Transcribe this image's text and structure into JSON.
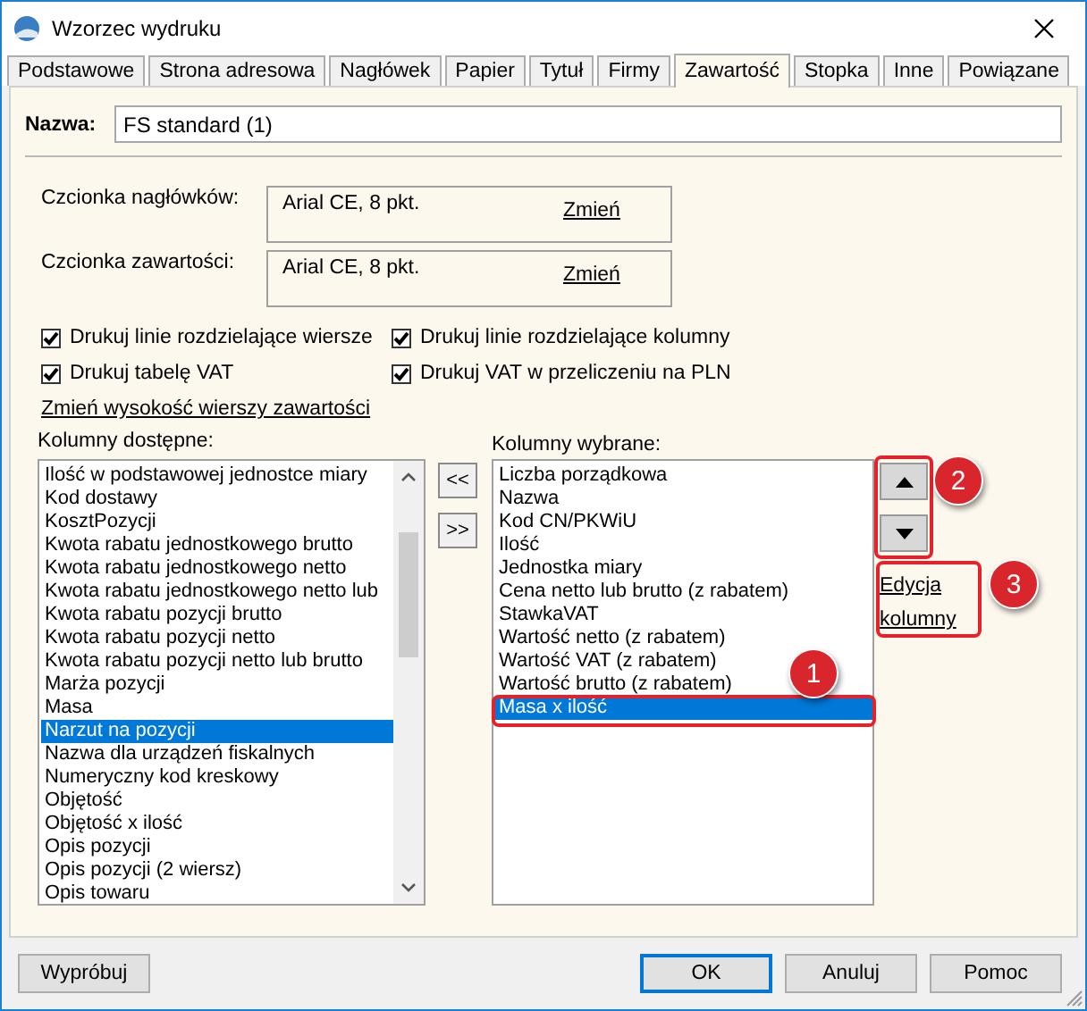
{
  "window": {
    "title": "Wzorzec wydruku"
  },
  "tabs": [
    {
      "label": "Podstawowe",
      "selected": false
    },
    {
      "label": "Strona adresowa",
      "selected": false
    },
    {
      "label": "Nagłówek",
      "selected": false
    },
    {
      "label": "Papier",
      "selected": false
    },
    {
      "label": "Tytuł",
      "selected": false
    },
    {
      "label": "Firmy",
      "selected": false
    },
    {
      "label": "Zawartość",
      "selected": true
    },
    {
      "label": "Stopka",
      "selected": false
    },
    {
      "label": "Inne",
      "selected": false
    },
    {
      "label": "Powiązane",
      "selected": false
    }
  ],
  "name_field": {
    "label": "Nazwa:",
    "value": "FS standard (1)"
  },
  "fonts": [
    {
      "label": "Czcionka nagłówków:",
      "value": "Arial CE, 8 pkt.",
      "link": "Zmień"
    },
    {
      "label": "Czcionka zawartości:",
      "value": "Arial CE, 8 pkt.",
      "link": "Zmień"
    }
  ],
  "checkboxes": [
    {
      "label": "Drukuj linie rozdzielające wiersze",
      "checked": true
    },
    {
      "label": "Drukuj linie rozdzielające kolumny",
      "checked": true
    },
    {
      "label": "Drukuj tabelę VAT",
      "checked": true
    },
    {
      "label": "Drukuj VAT w przeliczeniu na PLN",
      "checked": true
    }
  ],
  "row_height_link": "Zmień wysokość wierszy zawartości",
  "available": {
    "label": "Kolumny dostępne:",
    "items": [
      {
        "text": "Ilość w podstawowej jednostce miary",
        "selected": false
      },
      {
        "text": "Kod dostawy",
        "selected": false
      },
      {
        "text": "KosztPozycji",
        "selected": false
      },
      {
        "text": "Kwota rabatu jednostkowego brutto",
        "selected": false
      },
      {
        "text": "Kwota rabatu jednostkowego netto",
        "selected": false
      },
      {
        "text": "Kwota rabatu jednostkowego netto lub",
        "selected": false
      },
      {
        "text": "Kwota rabatu pozycji brutto",
        "selected": false
      },
      {
        "text": "Kwota rabatu pozycji netto",
        "selected": false
      },
      {
        "text": "Kwota rabatu pozycji netto lub brutto",
        "selected": false
      },
      {
        "text": "Marża pozycji",
        "selected": false
      },
      {
        "text": "Masa",
        "selected": false
      },
      {
        "text": "Narzut na pozycji",
        "selected": true
      },
      {
        "text": "Nazwa dla urządzeń fiskalnych",
        "selected": false
      },
      {
        "text": "Numeryczny kod kreskowy",
        "selected": false
      },
      {
        "text": "Objętość",
        "selected": false
      },
      {
        "text": "Objętość x ilość",
        "selected": false
      },
      {
        "text": "Opis pozycji",
        "selected": false
      },
      {
        "text": "Opis pozycji (2 wiersz)",
        "selected": false
      },
      {
        "text": "Opis towaru",
        "selected": false
      }
    ]
  },
  "move_buttons": [
    "<<",
    ">>"
  ],
  "chosen": {
    "label": "Kolumny wybrane:",
    "items": [
      {
        "text": "Liczba porządkowa",
        "selected": false
      },
      {
        "text": "Nazwa",
        "selected": false
      },
      {
        "text": "Kod CN/PKWiU",
        "selected": false
      },
      {
        "text": "Ilość",
        "selected": false
      },
      {
        "text": "Jednostka miary",
        "selected": false
      },
      {
        "text": "Cena netto lub brutto (z rabatem)",
        "selected": false
      },
      {
        "text": "StawkaVAT",
        "selected": false
      },
      {
        "text": "Wartość netto (z rabatem)",
        "selected": false
      },
      {
        "text": "Wartość VAT (z rabatem)",
        "selected": false
      },
      {
        "text": "Wartość brutto (z rabatem)",
        "selected": false
      },
      {
        "text": "Masa x ilość",
        "selected": true
      }
    ]
  },
  "edit_link": "Edycja kolumny",
  "callouts": [
    "1",
    "2",
    "3"
  ],
  "buttons": [
    {
      "label": "Wypróbuj",
      "default": false
    },
    {
      "label": "OK",
      "default": true
    },
    {
      "label": "Anuluj",
      "default": false
    },
    {
      "label": "Pomoc",
      "default": false
    }
  ]
}
